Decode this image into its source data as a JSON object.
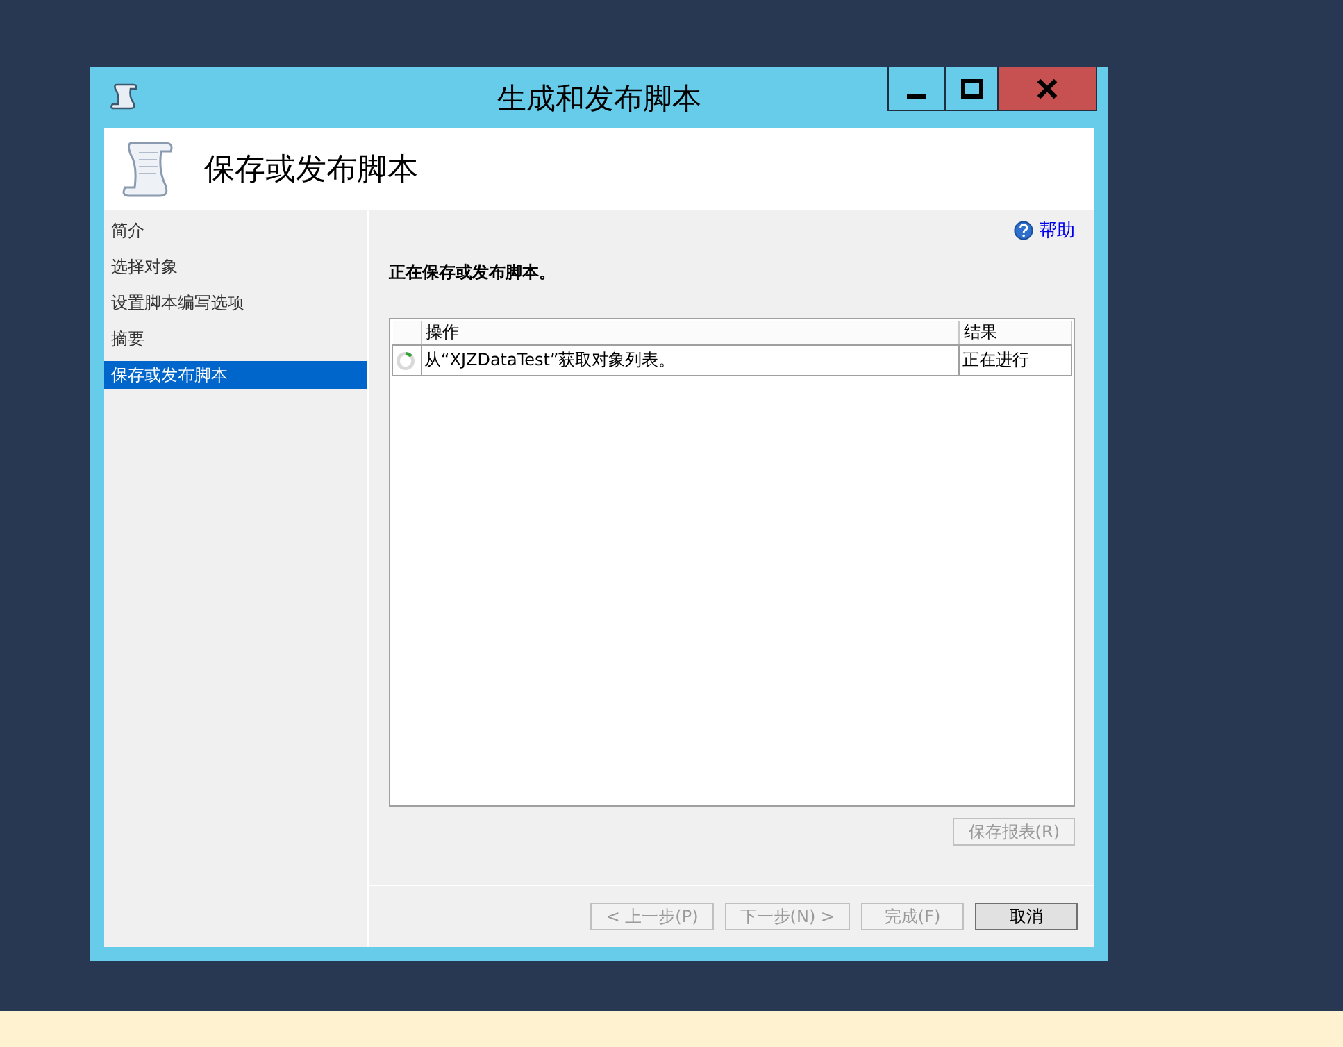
{
  "window": {
    "title": "生成和发布脚本"
  },
  "header": {
    "title": "保存或发布脚本"
  },
  "sidebar": {
    "items": [
      {
        "label": "简介",
        "selected": false
      },
      {
        "label": "选择对象",
        "selected": false
      },
      {
        "label": "设置脚本编写选项",
        "selected": false
      },
      {
        "label": "摘要",
        "selected": false
      },
      {
        "label": "保存或发布脚本",
        "selected": true
      }
    ]
  },
  "help_link": "帮助",
  "status_text": "正在保存或发布脚本。",
  "table": {
    "columns": [
      "操作",
      "结果"
    ],
    "rows": [
      {
        "kind": "in_progress",
        "action": "从“XJZDataTest”获取对象列表。",
        "result": "正在进行"
      }
    ]
  },
  "save_report_button": {
    "label": "保存报表(R)",
    "disabled": true
  },
  "buttons": [
    {
      "label": "< 上一步(P)",
      "disabled": true
    },
    {
      "label": "下一步(N) >",
      "disabled": true
    },
    {
      "label": "完成(F)",
      "disabled": true
    },
    {
      "label": "取消",
      "disabled": false
    }
  ]
}
